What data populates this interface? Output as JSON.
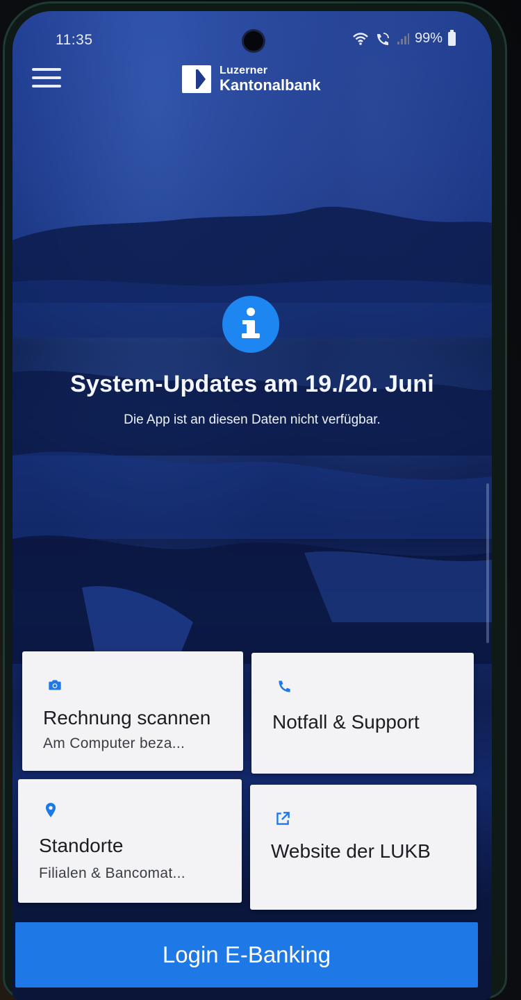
{
  "status_bar": {
    "time": "11:35",
    "battery": "99%"
  },
  "header": {
    "logo_line1": "Luzerner",
    "logo_line2": "Kantonalbank"
  },
  "notice": {
    "title": "System-Updates am 19./20. Juni",
    "subtitle": "Die App ist an diesen Daten nicht verfügbar."
  },
  "tiles": [
    {
      "title": "Rechnung scannen",
      "subtitle": "Am Computer beza...",
      "icon": "camera-icon"
    },
    {
      "title": "Notfall & Support",
      "subtitle": "",
      "icon": "phone-icon"
    },
    {
      "title": "Standorte",
      "subtitle": "Filialen & Bancomat...",
      "icon": "location-pin-icon"
    },
    {
      "title": "Website der LUKB",
      "subtitle": "",
      "icon": "external-link-icon"
    }
  ],
  "login": {
    "label": "Login E-Banking"
  },
  "colors": {
    "accent": "#1e78e6",
    "info_icon": "#1e86f0",
    "tile_background": "#f3f3f5"
  }
}
